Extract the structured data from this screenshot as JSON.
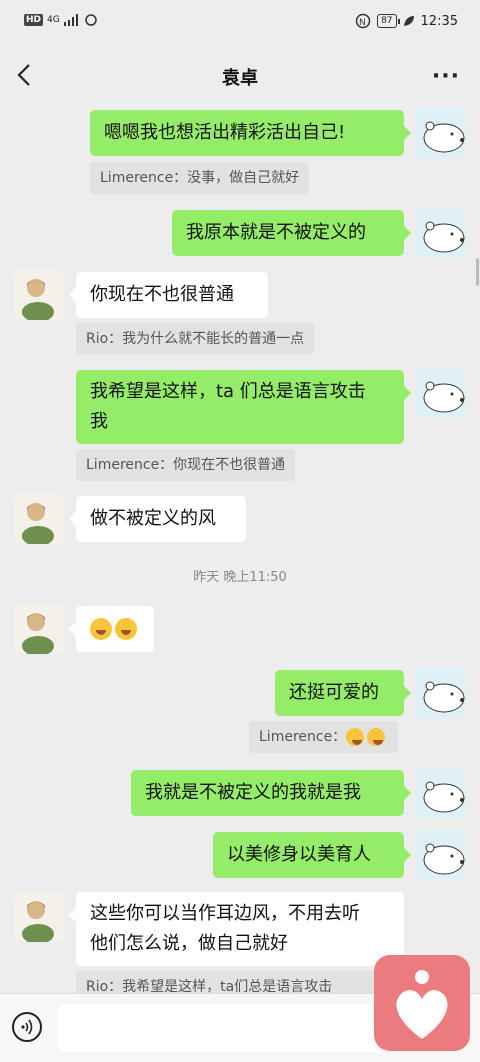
{
  "status_bar": {
    "network": "HD",
    "signal": "4G",
    "battery": "87",
    "time": "12:35"
  },
  "header": {
    "title": "袁卓"
  },
  "messages": [
    {
      "side": "me",
      "text": "嗯嗯我也想活出精彩活出自己!",
      "quote": "Limerence：没事，做自己就好"
    },
    {
      "side": "me",
      "text": "我原本就是不被定义的"
    },
    {
      "side": "other",
      "text": "你现在不也很普通",
      "quote": "Rio：我为什么就不能长的普通一点"
    },
    {
      "side": "me",
      "text": "我希望是这样，ta 们总是语言攻击",
      "text2": "我",
      "quote": "Limerence：你现在不也很普通"
    },
    {
      "side": "other",
      "text": "做不被定义的风"
    },
    {
      "side": "other",
      "emoji": "hugging-face emoji x2"
    },
    {
      "side": "me",
      "text": "还挺可爱的",
      "quote": "Limerence："
    },
    {
      "side": "me",
      "text": "我就是不被定义的我就是我"
    },
    {
      "side": "me",
      "text": "以美修身以美育人"
    },
    {
      "side": "other",
      "text": "这些你可以当作耳边风，不用去听",
      "text2": "他们怎么说，做自己就好",
      "quote": "Rio：我希望是这样，ta们总是语言攻击"
    }
  ],
  "timestamp": "昨天 晚上11:50",
  "input": {
    "placeholder": ""
  },
  "icons": {
    "back": "back-arrow-icon",
    "more": "more-icon",
    "voice": "voice-icon",
    "fab": "heart-icon"
  },
  "colors": {
    "my_bubble": "#95ec69",
    "other_bubble": "#ffffff",
    "background": "#ededed",
    "fab": "#ec7b80"
  }
}
